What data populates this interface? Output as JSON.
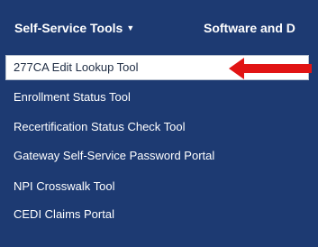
{
  "navbar": {
    "tools_label": "Self-Service Tools",
    "software_label": "Software and D"
  },
  "menu": {
    "items": [
      {
        "label": "277CA Edit Lookup Tool"
      },
      {
        "label": "Enrollment Status Tool"
      },
      {
        "label": "Recertification Status Check Tool"
      },
      {
        "label": "Gateway Self-Service Password Portal"
      },
      {
        "label": "NPI Crosswalk Tool"
      },
      {
        "label": "CEDI Claims Portal"
      }
    ]
  },
  "colors": {
    "navbar_bg": "#1d3a72",
    "selected_bg": "#ffffff",
    "arrow": "#e11414"
  }
}
